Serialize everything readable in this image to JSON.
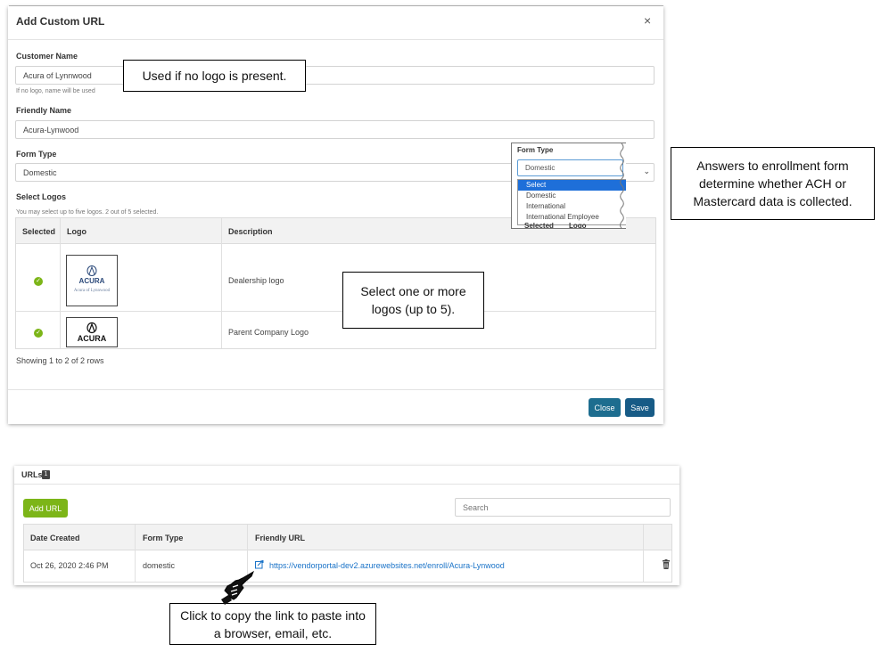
{
  "modal": {
    "title": "Add Custom URL",
    "close_glyph": "×",
    "customer_name": {
      "label": "Customer Name",
      "value": "Acura of Lynnwood",
      "help": "If no logo, name will be used"
    },
    "friendly_name": {
      "label": "Friendly Name",
      "value": "Acura-Lynwood"
    },
    "form_type": {
      "label": "Form Type",
      "value": "Domestic"
    },
    "select_logos": {
      "label": "Select Logos",
      "help": "You may select up to five logos. 2 out of 5 selected.",
      "columns": [
        "Selected",
        "Logo",
        "Description"
      ],
      "rows": [
        {
          "selected": true,
          "logo_text": "ACURA",
          "logo_subtext": "Acura of Lynnwood",
          "description": "Dealership logo"
        },
        {
          "selected": true,
          "logo_text": "ACURA",
          "logo_subtext": "",
          "description": "Parent Company Logo"
        }
      ],
      "footer": "Showing 1 to 2 of 2 rows"
    },
    "buttons": {
      "close": "Close",
      "save": "Save"
    }
  },
  "form_type_dropdown": {
    "title": "Form Type",
    "current": "Domestic",
    "options": [
      "Select",
      "Domestic",
      "International",
      "International Employee"
    ],
    "highlighted": "Select",
    "peek_columns": [
      "Selected",
      "Logo"
    ]
  },
  "callouts": {
    "no_logo": "Used if no logo is present.",
    "enrollment": "Answers to enrollment form determine whether ACH or Mastercard data is collected.",
    "select_logos": "Select one or more logos (up to 5).",
    "copy_link": "Click to copy the link to paste into a browser, email, etc."
  },
  "urls_panel": {
    "title": "URLs",
    "count": "1",
    "add_button": "Add URL",
    "search_placeholder": "Search",
    "columns": [
      "Date Created",
      "Form Type",
      "Friendly URL"
    ],
    "rows": [
      {
        "date_created": "Oct 26, 2020 2:46 PM",
        "form_type": "domestic",
        "friendly_url": "https://vendorportal-dev2.azurewebsites.net/enroll/Acura-Lynwood"
      }
    ]
  },
  "colors": {
    "primary_button": "#1d6d8f",
    "add_button": "#7cb518",
    "check": "#7cb518",
    "link": "#1a73c8",
    "dropdown_highlight": "#1e6fd9"
  }
}
